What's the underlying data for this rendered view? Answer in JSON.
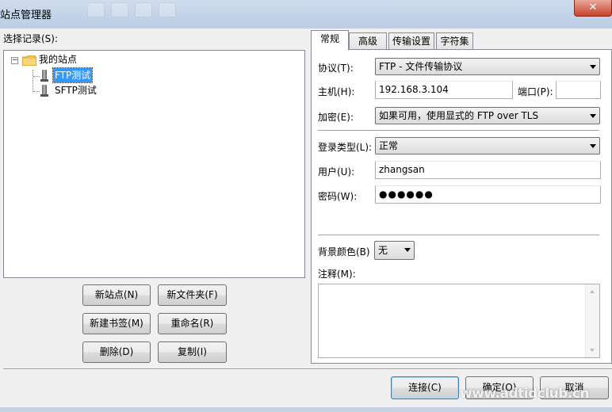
{
  "window": {
    "title": "站点管理器",
    "close_glyph": "✕"
  },
  "left": {
    "select_label": "选择记录(S):",
    "tree": {
      "root_label": "我的站点",
      "items": [
        {
          "label": "FTP测试",
          "selected": true
        },
        {
          "label": "SFTP测试",
          "selected": false
        }
      ]
    },
    "buttons": {
      "new_site": "新站点(N)",
      "new_folder": "新文件夹(F)",
      "new_bookmark": "新建书签(M)",
      "rename": "重命名(R)",
      "delete": "删除(D)",
      "copy": "复制(I)"
    }
  },
  "tabs": [
    {
      "label": "常规",
      "active": true
    },
    {
      "label": "高级",
      "active": false
    },
    {
      "label": "传输设置",
      "active": false
    },
    {
      "label": "字符集",
      "active": false
    }
  ],
  "general": {
    "protocol_label": "协议(T):",
    "protocol_value": "FTP - 文件传输协议",
    "host_label": "主机(H):",
    "host_value": "192.168.3.104",
    "port_label": "端口(P):",
    "port_value": "",
    "encryption_label": "加密(E):",
    "encryption_value": "如果可用，使用显式的 FTP over TLS",
    "logon_type_label": "登录类型(L):",
    "logon_type_value": "正常",
    "user_label": "用户(U):",
    "user_value": "zhangsan",
    "password_label": "密码(W):",
    "password_value": "●●●●●●",
    "bg_color_label": "背景颜色(B)",
    "bg_color_value": "无",
    "comments_label": "注释(M):"
  },
  "dialog_buttons": {
    "connect": "连接(C)",
    "ok": "确定(O)",
    "cancel": "取消"
  },
  "watermark": "www.adtidclub.cn"
}
